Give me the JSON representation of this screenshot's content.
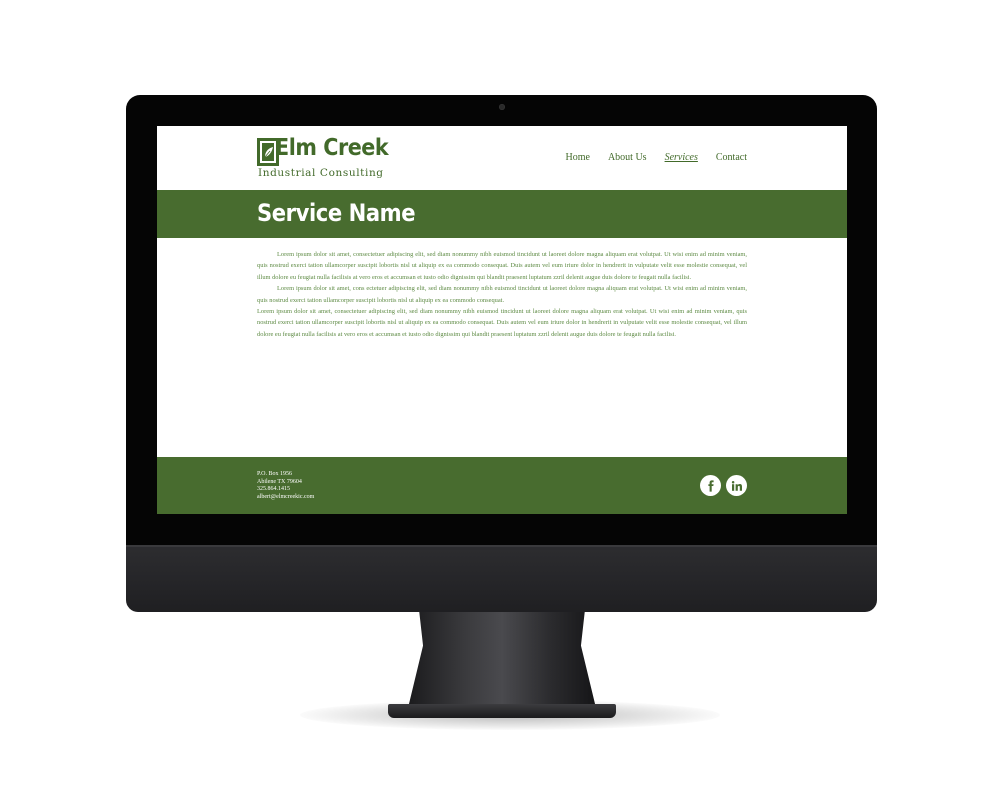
{
  "header": {
    "logo": {
      "title": "Elm Creek",
      "subtitle": "Industrial Consulting"
    },
    "nav": [
      {
        "label": "Home",
        "active": false
      },
      {
        "label": "About Us",
        "active": false
      },
      {
        "label": "Services",
        "active": true
      },
      {
        "label": "Contact",
        "active": false
      }
    ]
  },
  "banner": {
    "title": "Service Name"
  },
  "content": {
    "paragraphs": [
      "Lorem ipsum dolor sit amet, consectetuer adipiscing elit, sed diam nonummy nibh euismod tincidunt ut laoreet dolore magna aliquam erat volutpat. Ut wisi enim ad minim veniam, quis nostrud exerci tation ullamcorper suscipit lobortis nisl ut aliquip ex ea commodo consequat. Duis autem vel eum iriure dolor in hendrerit in vulputate velit esse molestie consequat, vel illum dolore eu feugiat nulla facilisis at vero eros et accumsan et iusto odio dignissim qui blandit praesent luptatum zzril delenit augue duis dolore te feugait nulla facilisi.",
      "Lorem ipsum dolor sit amet, cons ectetuer adipiscing elit, sed diam nonummy nibh euismod tincidunt ut laoreet dolore magna aliquam erat volutpat. Ut wisi enim ad minim veniam, quis nostrud exerci tation ullamcorper suscipit lobortis nisl ut aliquip ex ea commodo consequat.",
      "Lorem ipsum dolor sit amet, consectetuer adipiscing elit, sed diam nonummy nibh euismod tincidunt ut laoreet dolore magna aliquam erat volutpat. Ut wisi enim ad minim veniam, quis nostrud exerci tation ullamcorper suscipit lobortis nisl ut aliquip ex ea commodo consequat. Duis autem vel eum iriure dolor in hendrerit in vulputate velit esse molestie consequat, vel illum dolore eu feugiat nulla facilisis at vero eros et accumsan et iusto odio dignissim qui blandit praesent luptatum zzril delenit augue duis dolore te feugait nulla facilisi."
    ]
  },
  "footer": {
    "address": [
      "P.O. Box 1956",
      "Abilene TX  79604",
      "325.864.1415",
      "albert@elmcreekic.com"
    ],
    "social": [
      {
        "icon": "facebook-icon"
      },
      {
        "icon": "linkedin-icon"
      }
    ]
  },
  "colors": {
    "brand_green": "#486c2f",
    "text_green": "#5d8a43",
    "logo_green": "#426a2a",
    "bezel": "#050505",
    "chin": "#2d2d30"
  }
}
